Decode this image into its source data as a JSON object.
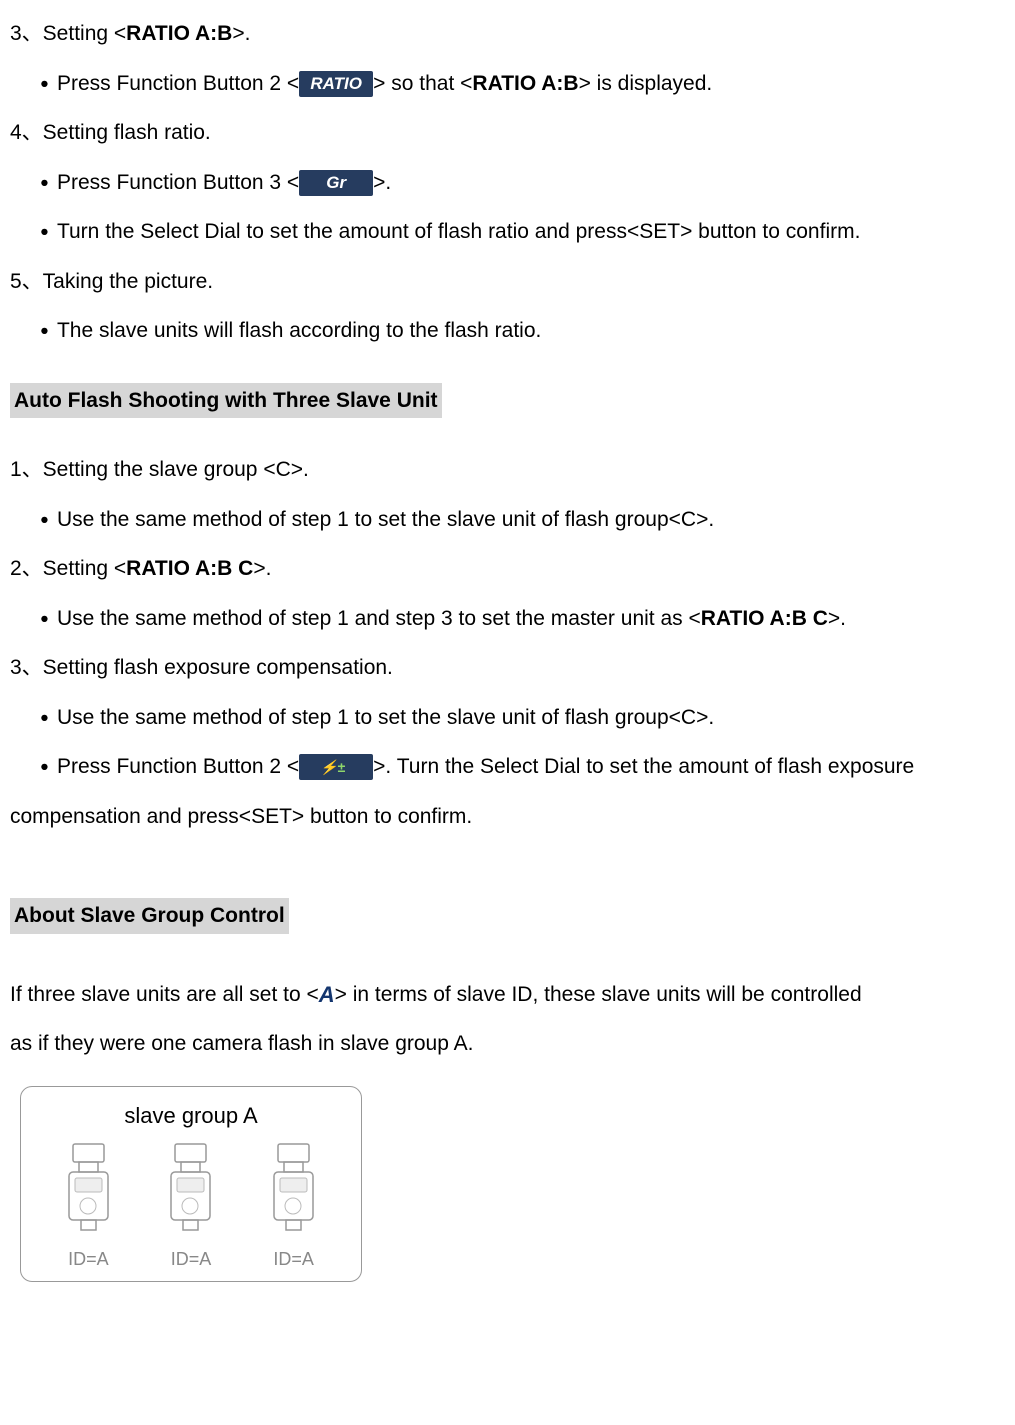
{
  "step3": {
    "prefix": "3、Setting <",
    "bold": "RATIO A:B",
    "suffix": ">."
  },
  "step3_b1": {
    "pre": "Press Function Button 2 <",
    "icon": "RATIO",
    "mid": "> so that <",
    "bold": "RATIO A:B",
    "post": "> is displayed."
  },
  "step4": "4、Setting flash ratio.",
  "step4_b1": {
    "pre": "Press Function Button 3 <",
    "icon": "Gr",
    "post": ">."
  },
  "step4_b2": "Turn the Select Dial to set the amount of flash ratio and press<SET> button to confirm.",
  "step5": "5、Taking the picture.",
  "step5_b1": "The slave units will flash according to the flash ratio.",
  "section1": "Auto Flash Shooting with Three Slave Unit",
  "t_step1": "1、Setting the slave group <C>.",
  "t_step1_b1": "Use the same method of step 1 to set the slave unit of flash group<C>.",
  "t_step2": {
    "prefix": "2、Setting <",
    "bold": "RATIO A:B C",
    "suffix": ">."
  },
  "t_step2_b1": {
    "pre": "Use the same method of step 1 and step 3 to set the master unit as <",
    "bold": "RATIO A:B C",
    "post": ">."
  },
  "t_step3": "3、Setting flash exposure compensation.",
  "t_step3_b1": "Use the same method of step 1 to set the slave unit of flash group<C>.",
  "t_step3_b2": {
    "pre": "Press Function Button 2 <",
    "post": ">. Turn the Select Dial to set the amount of flash exposure"
  },
  "t_step3_cont": "compensation and press<SET> button to confirm.",
  "section2": "About Slave Group Control",
  "about_text1": {
    "pre": "If three slave units are all set to <",
    "icon": "A",
    "post": "> in terms of slave ID, these slave units will be controlled"
  },
  "about_text2": "as if they were one camera flash in slave group A.",
  "diagram": {
    "title": "slave group A",
    "labels": [
      "ID=A",
      "ID=A",
      "ID=A"
    ]
  }
}
